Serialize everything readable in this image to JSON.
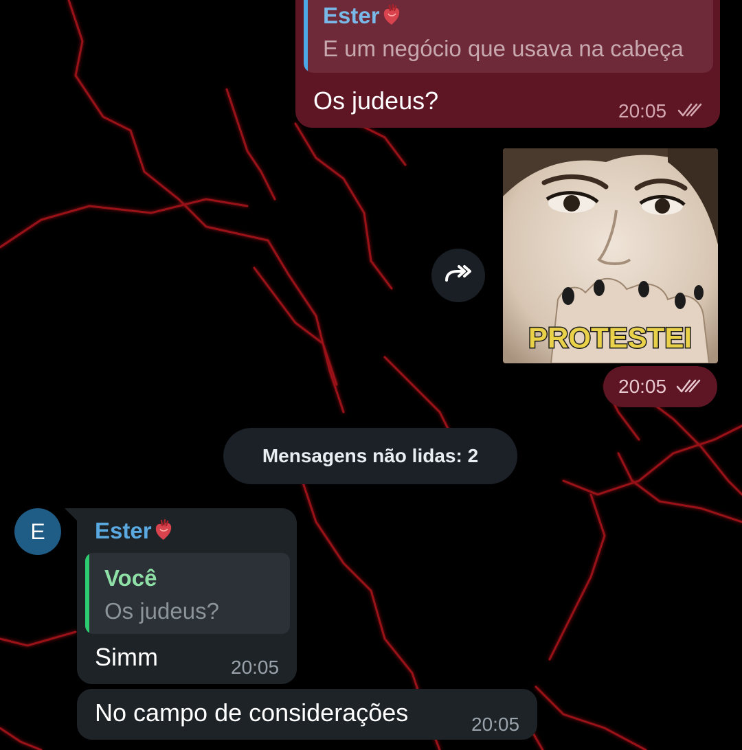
{
  "messages": {
    "outgoing_reply": {
      "quote_author": "Ester",
      "quote_text": "E um negócio que usava na cabeça",
      "text": "Os judeus?",
      "time": "20:05"
    },
    "sticker": {
      "caption": "PROTESTEI",
      "time": "20:05"
    },
    "unread_divider": "Mensagens não lidas: 2",
    "incoming_reply": {
      "author": "Ester",
      "avatar_letter": "E",
      "quote_author": "Você",
      "quote_text": "Os judeus?",
      "text": "Simm",
      "time": "20:05"
    },
    "incoming_followup": {
      "text": "No campo de considerações",
      "time": "20:05"
    }
  },
  "icons": {
    "forward": "share-forward-icon",
    "read_receipt": "double-check-icon",
    "emoji": "anatomical-heart-emoji"
  },
  "colors": {
    "outgoing_bubble": "#5e1524",
    "incoming_bubble": "#1e2328",
    "link_name": "#5aa9e0",
    "quote_self": "#2ecc71"
  }
}
